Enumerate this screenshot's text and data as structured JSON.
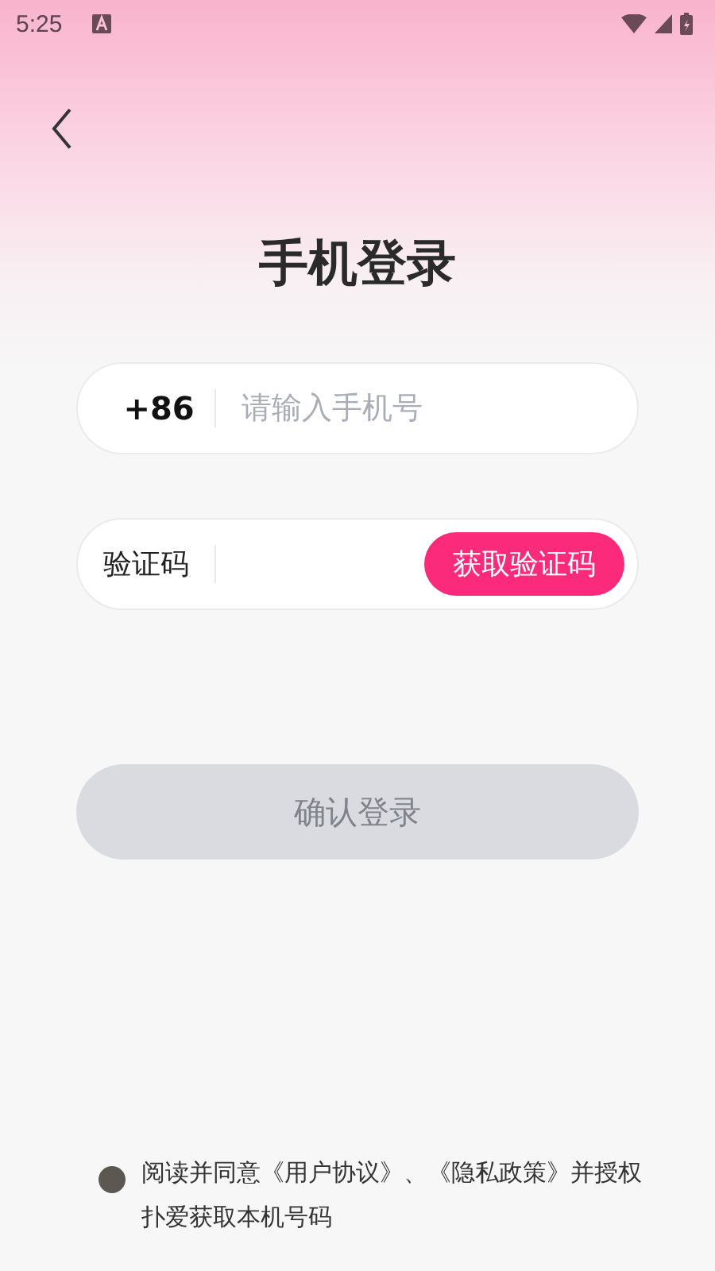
{
  "status_bar": {
    "time": "5:25"
  },
  "title": "手机登录",
  "phone_field": {
    "prefix": "+86",
    "placeholder": "请输入手机号"
  },
  "code_field": {
    "label": "验证码",
    "button": "获取验证码"
  },
  "login_button": {
    "label": "确认登录",
    "disabled": true
  },
  "agreement": {
    "checked": false,
    "text": "阅读并同意《用户协议》、《隐私政策》并授权扑爱获取本机号码"
  }
}
